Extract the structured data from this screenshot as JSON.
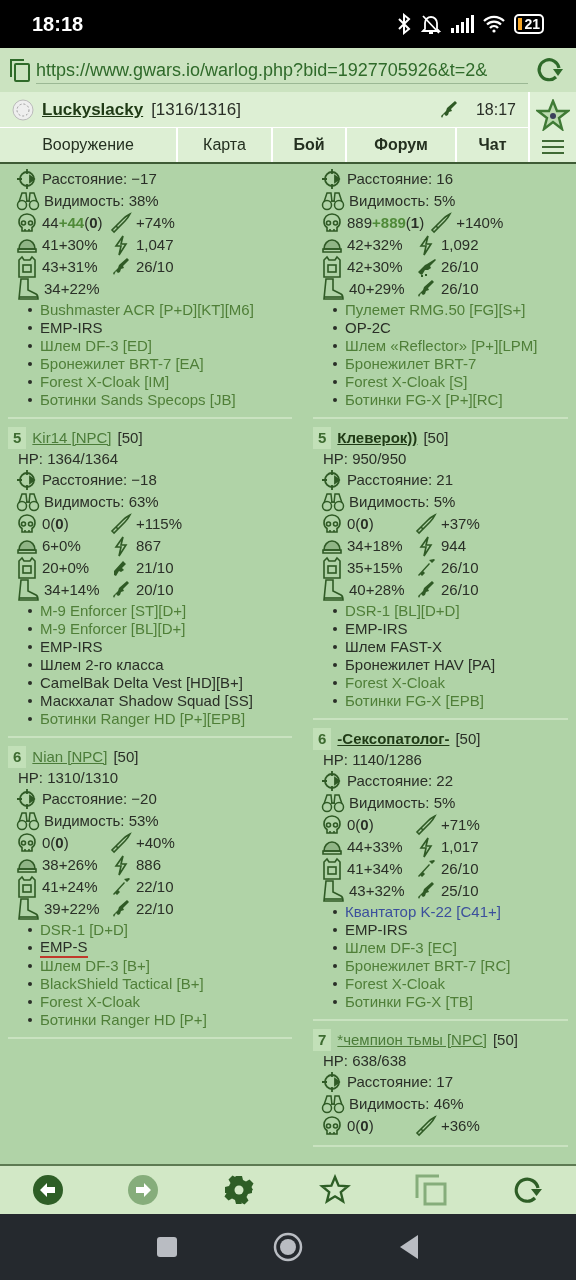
{
  "status_bar": {
    "time": "18:18",
    "battery": "21"
  },
  "address_bar": {
    "url": "https://www.gwars.io/warlog.php?bid=1927705926&t=2&"
  },
  "header": {
    "user": "Luckyslacky",
    "hp": "[1316/1316]",
    "time": "18:17",
    "tabs": [
      {
        "label": "Вооружение",
        "highlighted": false
      },
      {
        "label": "Карта",
        "highlighted": false
      },
      {
        "label": "Бой",
        "highlighted": true
      },
      {
        "label": "Форум",
        "highlighted": true
      },
      {
        "label": "Чат",
        "highlighted": true
      }
    ]
  },
  "columns": [
    [
      {
        "distance": "Расстояние: −17",
        "visibility": "Видимость: 38%",
        "stats": [
          {
            "left": {
              "kind": "skull",
              "text": "44",
              "bonus": "+44",
              "count": "(**0**)"
            },
            "right": {
              "kind": "bullet",
              "text": "+74%"
            }
          },
          {
            "left": {
              "kind": "helmet",
              "text": "41+30%"
            },
            "right": {
              "kind": "bolt",
              "text": "1,047"
            }
          },
          {
            "left": {
              "kind": "vest",
              "text": "43+31%"
            },
            "right": {
              "kind": "rifle",
              "text": "26/10"
            }
          },
          {
            "left": {
              "kind": "boot",
              "text": "34+22%"
            }
          }
        ],
        "items": [
          {
            "text": "Bushmaster ACR [P+D][KT][M6]",
            "color": "#4f7f38"
          },
          {
            "text": "EMP-IRS",
            "color": "#2a2f27"
          },
          {
            "text": "Шлем DF-3 [ED]",
            "color": "#4f7f38"
          },
          {
            "text": "Бронежилет BRT-7 [EA]",
            "color": "#4f7f38"
          },
          {
            "text": "Forest X-Cloak [IM]",
            "color": "#4f7f38"
          },
          {
            "text": "Ботинки Sands Specops [JB]",
            "color": "#4f7f38"
          }
        ]
      },
      {
        "number": "5",
        "name": "Kir14 [NPC]",
        "kind": "npc",
        "level": "[50]",
        "hp": "HP: 1364/1364",
        "distance": "Расстояние: −18",
        "visibility": "Видимость: 63%",
        "stats": [
          {
            "left": {
              "kind": "skull",
              "text": "0",
              "count": "(**0**)"
            },
            "right": {
              "kind": "bullet",
              "text": "+115%"
            }
          },
          {
            "left": {
              "kind": "helmet",
              "text": "6+0%"
            },
            "right": {
              "kind": "bolt",
              "text": "867"
            }
          },
          {
            "left": {
              "kind": "vest",
              "text": "20+0%"
            },
            "right": {
              "kind": "pistol",
              "text": "21/10"
            }
          },
          {
            "left": {
              "kind": "boot",
              "text": "34+14%"
            },
            "right": {
              "kind": "rifle",
              "text": "20/10"
            }
          }
        ],
        "items": [
          {
            "text": "M-9 Enforcer [ST][D+]",
            "color": "#4f7f38"
          },
          {
            "text": "M-9 Enforcer [BL][D+]",
            "color": "#4f7f38"
          },
          {
            "text": "EMP-IRS",
            "color": "#2a2f27"
          },
          {
            "text": "Шлем 2-го класса",
            "color": "#2a2f27"
          },
          {
            "text": "CamelBak Delta Vest [HD][B+]",
            "color": "#2a2f27"
          },
          {
            "text": "Маскхалат Shadow Squad [SS]",
            "color": "#2a2f27"
          },
          {
            "text": "Ботинки Ranger HD [P+][EPB]",
            "color": "#4f7f38"
          }
        ]
      },
      {
        "number": "6",
        "name": "Nian [NPC]",
        "kind": "npc",
        "level": "[50]",
        "hp": "HP: 1310/1310",
        "distance": "Расстояние: −20",
        "visibility": "Видимость: 53%",
        "stats": [
          {
            "left": {
              "kind": "skull",
              "text": "0",
              "count": "(**0**)"
            },
            "right": {
              "kind": "bullet",
              "text": "+40%"
            }
          },
          {
            "left": {
              "kind": "helmet",
              "text": "38+26%"
            },
            "right": {
              "kind": "bolt",
              "text": "886"
            }
          },
          {
            "left": {
              "kind": "vest",
              "text": "41+24%"
            },
            "right": {
              "kind": "sniper",
              "text": "22/10"
            }
          },
          {
            "left": {
              "kind": "boot",
              "text": "39+22%"
            },
            "right": {
              "kind": "rifle",
              "text": "22/10"
            }
          }
        ],
        "items": [
          {
            "text": "DSR-1 [D+D]",
            "color": "#4f7f38",
            "marked": false
          },
          {
            "text": "EMP-S",
            "color": "#2a2f27",
            "marked": true
          },
          {
            "text": "Шлем DF-3 [B+]",
            "color": "#4f7f38",
            "marked": false
          },
          {
            "text": "BlackShield Tactical [B+]",
            "color": "#4f7f38",
            "marked": false
          },
          {
            "text": "Forest X-Cloak",
            "color": "#4f7f38",
            "marked": false
          },
          {
            "text": "Ботинки Ranger HD [P+]",
            "color": "#4f7f38",
            "marked": false
          }
        ]
      }
    ],
    [
      {
        "distance": "Расстояние: 16",
        "visibility": "Видимость: 5%",
        "stats": [
          {
            "left": {
              "kind": "skull",
              "text": "889",
              "bonus": "+889",
              "count": "(**1**)"
            },
            "right": {
              "kind": "bullet",
              "text": "+140%"
            }
          },
          {
            "left": {
              "kind": "helmet",
              "text": "42+32%"
            },
            "right": {
              "kind": "bolt",
              "text": "1,092"
            }
          },
          {
            "left": {
              "kind": "vest",
              "text": "42+30%"
            },
            "right": {
              "kind": "machinegun",
              "text": "26/10"
            }
          },
          {
            "left": {
              "kind": "boot",
              "text": "40+29%"
            },
            "right": {
              "kind": "rifle",
              "text": "26/10"
            }
          }
        ],
        "items": [
          {
            "text": "Пулемет RMG.50 [FG][S+]",
            "color": "#4f7f38"
          },
          {
            "text": "OP-2C",
            "color": "#2a2f27"
          },
          {
            "text": "Шлем «Reflector» [P+][LPM]",
            "color": "#4f7f38"
          },
          {
            "text": "Бронежилет BRT-7",
            "color": "#4f7f38"
          },
          {
            "text": "Forest X-Cloak [S]",
            "color": "#4f7f38"
          },
          {
            "text": "Ботинки FG-X [P+][RC]",
            "color": "#4f7f38"
          }
        ]
      },
      {
        "number": "5",
        "name": "Клеверок))",
        "kind": "player",
        "level": "[50]",
        "hp": "HP: 950/950",
        "distance": "Расстояние: 21",
        "visibility": "Видимость: 5%",
        "stats": [
          {
            "left": {
              "kind": "skull",
              "text": "0",
              "count": "(**0**)"
            },
            "right": {
              "kind": "bullet",
              "text": "+37%"
            }
          },
          {
            "left": {
              "kind": "helmet",
              "text": "34+18%"
            },
            "right": {
              "kind": "bolt",
              "text": "944"
            }
          },
          {
            "left": {
              "kind": "vest",
              "text": "35+15%"
            },
            "right": {
              "kind": "sniper",
              "text": "26/10"
            }
          },
          {
            "left": {
              "kind": "boot",
              "text": "40+28%"
            },
            "right": {
              "kind": "rifle",
              "text": "26/10"
            }
          }
        ],
        "items": [
          {
            "text": "DSR-1 [BL][D+D]",
            "color": "#4f7f38"
          },
          {
            "text": "EMP-IRS",
            "color": "#2a2f27"
          },
          {
            "text": "Шлем FAST-X",
            "color": "#2a2f27"
          },
          {
            "text": "Бронежилет HAV [PA]",
            "color": "#2a2f27"
          },
          {
            "text": "Forest X-Cloak",
            "color": "#4f7f38"
          },
          {
            "text": "Ботинки FG-X [EPB]",
            "color": "#4f7f38"
          }
        ]
      },
      {
        "number": "6",
        "name": "-Сексопатолог-",
        "kind": "player",
        "level": "[50]",
        "hp": "HP: 1140/1286",
        "distance": "Расстояние: 22",
        "visibility": "Видимость: 5%",
        "stats": [
          {
            "left": {
              "kind": "skull",
              "text": "0",
              "count": "(**0**)"
            },
            "right": {
              "kind": "bullet",
              "text": "+71%"
            }
          },
          {
            "left": {
              "kind": "helmet",
              "text": "44+33%"
            },
            "right": {
              "kind": "bolt",
              "text": "1,017"
            }
          },
          {
            "left": {
              "kind": "vest",
              "text": "41+34%"
            },
            "right": {
              "kind": "sniper",
              "text": "26/10"
            }
          },
          {
            "left": {
              "kind": "boot",
              "text": "43+32%"
            },
            "right": {
              "kind": "rifle",
              "text": "25/10"
            }
          }
        ],
        "items": [
          {
            "text": "Квантатор K-22 [C41+]",
            "color": "#3b4f9c"
          },
          {
            "text": "EMP-IRS",
            "color": "#2a2f27"
          },
          {
            "text": "Шлем DF-3 [EC]",
            "color": "#4f7f38"
          },
          {
            "text": "Бронежилет BRT-7 [RC]",
            "color": "#4f7f38"
          },
          {
            "text": "Forest X-Cloak",
            "color": "#4f7f38"
          },
          {
            "text": "Ботинки FG-X [TB]",
            "color": "#4f7f38"
          }
        ]
      },
      {
        "number": "7",
        "name": "*чемпион тьмы [NPC]",
        "kind": "npc",
        "level": "[50]",
        "hp": "HP: 638/638",
        "distance": "Расстояние: 17",
        "visibility": "Видимость: 46%",
        "stats": [
          {
            "left": {
              "kind": "skull",
              "text": "0",
              "count": "(**0**)"
            },
            "right": {
              "kind": "bullet",
              "text": "+36%"
            }
          }
        ]
      }
    ]
  ]
}
